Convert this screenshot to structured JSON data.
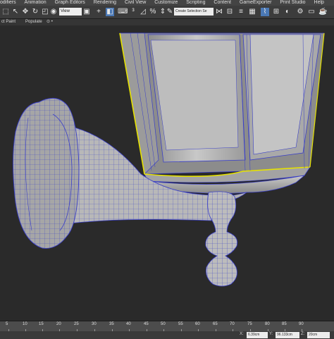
{
  "menu": {
    "items": [
      "odifiers",
      "Animation",
      "Graph Editors",
      "Rendering",
      "Civil View",
      "Customize",
      "Scripting",
      "Content",
      "GameExporter",
      "Print Studio",
      "Help"
    ]
  },
  "toolbar": {
    "view_select": "View",
    "named_selection": "Create Selection Se"
  },
  "ribbon": {
    "left": "ct Paint",
    "right": "Populate",
    "dropdown": "⊙ •"
  },
  "timeline": {
    "ticks": [
      "5",
      "10",
      "15",
      "20",
      "25",
      "30",
      "35",
      "40",
      "45",
      "50",
      "55",
      "60",
      "65",
      "70",
      "75",
      "80",
      "85",
      "90"
    ]
  },
  "status": {
    "x_value": "6.39cm",
    "y_value": "96.133cm",
    "z_value": "20cm",
    "x_label": "X:",
    "y_label": "Y:",
    "z_label": "Z:"
  },
  "colors": {
    "wire": "#3a3fc8",
    "selection": "#e6e200",
    "surface": "#b5b5b5"
  }
}
